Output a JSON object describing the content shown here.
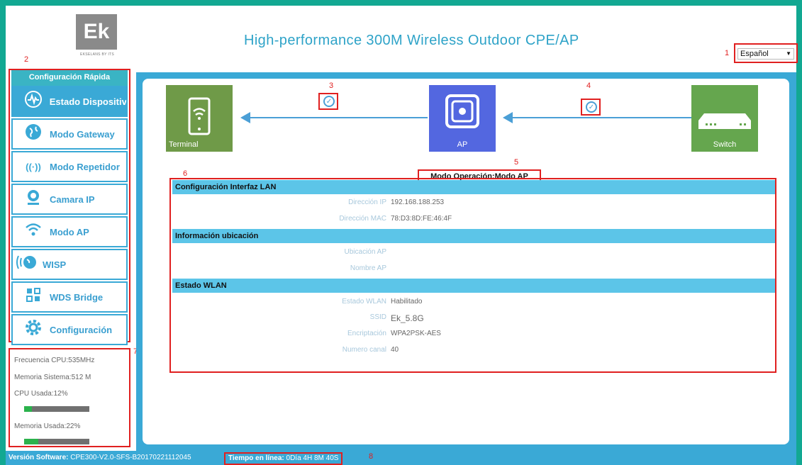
{
  "header": {
    "logo_text": "Ek",
    "logo_sub": "EKSELANS BY ITS",
    "title": "High-performance 300M Wireless Outdoor CPE/AP",
    "language": "Español"
  },
  "markers": [
    "1",
    "2",
    "3",
    "4",
    "5",
    "6",
    "7",
    "8"
  ],
  "sidebar": {
    "quick_config": "Configuración Rápida",
    "items": [
      {
        "label": "Estado Dispositiv",
        "icon": "pulse-icon",
        "glyph": "〰"
      },
      {
        "label": "Modo Gateway",
        "icon": "globe-icon",
        "glyph": "🌐"
      },
      {
        "label": "Modo Repetidor",
        "icon": "antenna-icon",
        "glyph": "📶"
      },
      {
        "label": "Camara IP",
        "icon": "camera-icon",
        "glyph": "◉"
      },
      {
        "label": "Modo AP",
        "icon": "wifi-icon",
        "glyph": "≋"
      },
      {
        "label": "WISP",
        "icon": "wisp-icon",
        "glyph": "◎"
      },
      {
        "label": "WDS Bridge",
        "icon": "bridge-icon",
        "glyph": "▚"
      },
      {
        "label": "Configuración",
        "icon": "gear-icon",
        "glyph": "⚙"
      }
    ]
  },
  "stats": {
    "cpu_freq": "Frecuencia CPU:535MHz",
    "memory": "Memoria Sistema:512 M",
    "cpu_used": "CPU Usada:12%",
    "cpu_fraction": 0.12,
    "mem_used": "Memoria Usada:22%",
    "mem_fraction": 0.22
  },
  "topology": {
    "terminal": "Terminal",
    "ap": "AP",
    "switch": "Switch",
    "mode": "Modo Operación:Modo AP"
  },
  "config": {
    "lan": {
      "title": "Configuración Interfaz LAN",
      "ip_label": "Dirección IP",
      "ip_value": "192.168.188.253",
      "mac_label": "Dirección MAC",
      "mac_value": "78:D3:8D:FE:46:4F"
    },
    "location": {
      "title": "Información ubicación",
      "ap_location_label": "Ubicación AP",
      "ap_name_label": "Nombre AP"
    },
    "wlan": {
      "title": "Estado WLAN",
      "state_label": "Estado WLAN",
      "state_value": "Habilitado",
      "ssid_label": "SSID",
      "ssid_value": "Ek_5.8G",
      "enc_label": "Encriptación",
      "enc_value": "WPA2PSK-AES",
      "channel_label": "Numero canal",
      "channel_value": "40"
    }
  },
  "footer": {
    "version_label": "Versión Software:",
    "version_value": "CPE300-V2.0-SFS-B20170221112045",
    "uptime_label": "Tiempo en línea:",
    "uptime_value": "0Día 4H 8M 40S"
  }
}
